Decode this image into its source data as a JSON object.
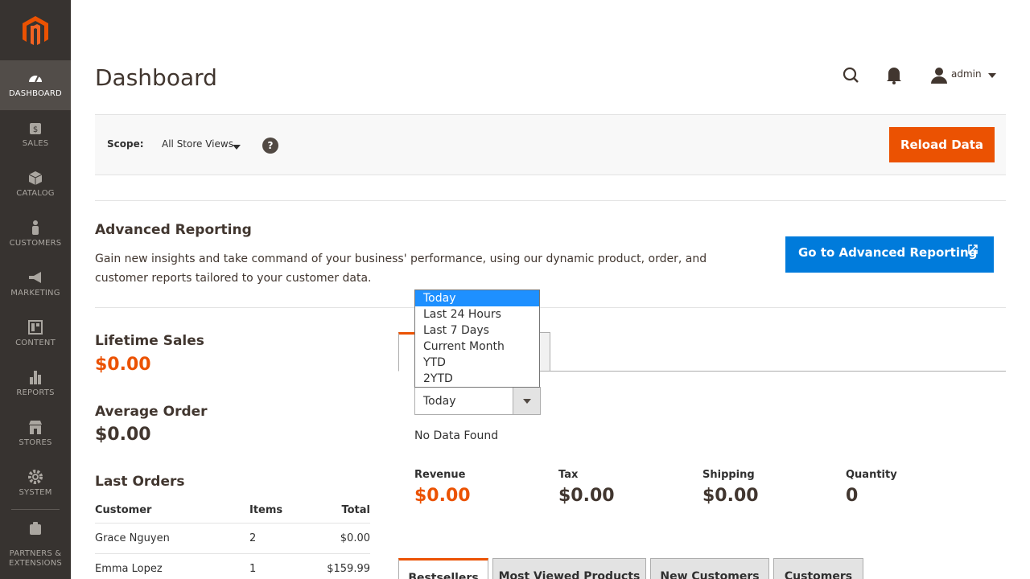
{
  "header": {
    "title": "Dashboard",
    "user": "admin"
  },
  "sidebar": {
    "items": [
      {
        "label": "Dashboard",
        "icon": "dashboard-icon",
        "active": true
      },
      {
        "label": "Sales",
        "icon": "dollar-icon"
      },
      {
        "label": "Catalog",
        "icon": "box-icon"
      },
      {
        "label": "Customers",
        "icon": "person-icon"
      },
      {
        "label": "Marketing",
        "icon": "megaphone-icon"
      },
      {
        "label": "Content",
        "icon": "layout-icon"
      },
      {
        "label": "Reports",
        "icon": "bar-chart-icon"
      },
      {
        "label": "Stores",
        "icon": "store-icon"
      },
      {
        "label": "System",
        "icon": "gear-icon"
      },
      {
        "label": "Partners & Extensions",
        "icon": "puzzle-icon"
      }
    ]
  },
  "scope": {
    "label": "Scope:",
    "value": "All Store Views",
    "help": "?"
  },
  "reload_button": "Reload Data",
  "advanced_reporting": {
    "title": "Advanced Reporting",
    "description": "Gain new insights and take command of your business' performance, using our dynamic product, order, and customer reports tailored to your customer data.",
    "button": "Go to Advanced Reporting"
  },
  "lifetime_sales": {
    "label": "Lifetime Sales",
    "value": "$0.00"
  },
  "average_order": {
    "label": "Average Order",
    "value": "$0.00"
  },
  "last_orders": {
    "title": "Last Orders",
    "columns": [
      "Customer",
      "Items",
      "Total"
    ],
    "rows": [
      {
        "customer": "Grace Nguyen",
        "items": "2",
        "total": "$0.00"
      },
      {
        "customer": "Emma Lopez",
        "items": "1",
        "total": "$159.99"
      }
    ]
  },
  "period": {
    "selected": "Today",
    "options": [
      "Today",
      "Last 24 Hours",
      "Last 7 Days",
      "Current Month",
      "YTD",
      "2YTD"
    ]
  },
  "chart": {
    "no_data": "No Data Found"
  },
  "totals": [
    {
      "label": "Revenue",
      "value": "$0.00"
    },
    {
      "label": "Tax",
      "value": "$0.00"
    },
    {
      "label": "Shipping",
      "value": "$0.00"
    },
    {
      "label": "Quantity",
      "value": "0"
    }
  ],
  "grid_tabs": [
    "Bestsellers",
    "Most Viewed Products",
    "New Customers",
    "Customers"
  ],
  "colors": {
    "accent": "#eb5202",
    "sidebar": "#373330",
    "link_button": "#007bdb"
  }
}
